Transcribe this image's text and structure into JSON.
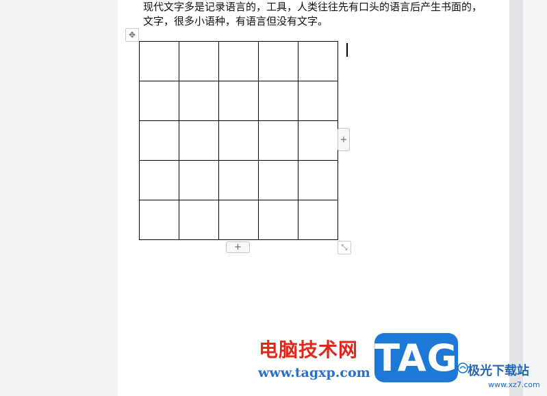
{
  "document": {
    "paragraph": "现代文字多是记录语言的，工具，人类往往先有口头的语言后产生书面的，文字，很多小语种，有语言但没有文字。",
    "table": {
      "rows": 5,
      "columns": 5
    }
  },
  "table_controls": {
    "move_icon": "move-cross-icon",
    "add_column_label": "+",
    "add_row_label": "+",
    "resize_icon": "resize-diagonal-icon"
  },
  "watermark": {
    "cn_text": "电脑技术网",
    "url_text": "www.tagxp.com",
    "tag_text": "TAG",
    "site_cn": "极光下载站",
    "site_url": "www.xz7.com",
    "colors": {
      "red": "#e1261c",
      "blue": "#1e79d6"
    }
  }
}
